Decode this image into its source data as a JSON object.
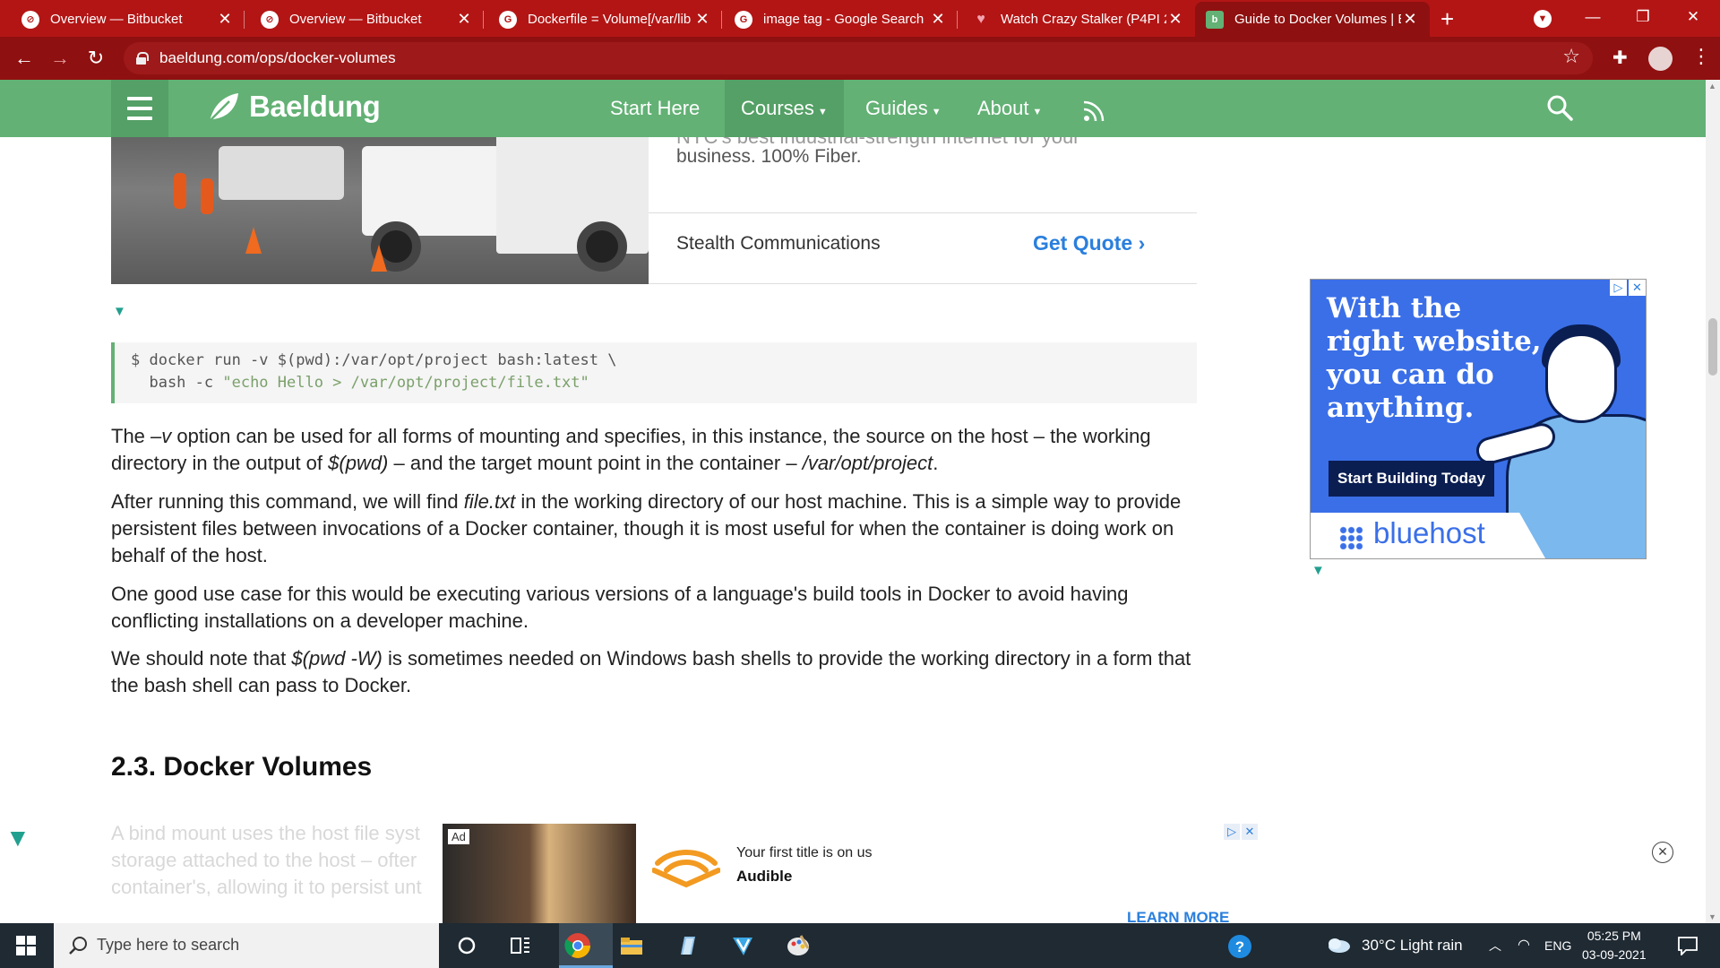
{
  "browser": {
    "tabs": [
      {
        "title": "Overview — Bitbucket",
        "icon": "bitbucket-icon"
      },
      {
        "title": "Overview — Bitbucket",
        "icon": "bitbucket-icon"
      },
      {
        "title": "Dockerfile = Volume[/var/lib",
        "icon": "google-icon"
      },
      {
        "title": "image tag - Google Search",
        "icon": "google-icon"
      },
      {
        "title": "Watch Crazy Stalker (P4PI 2",
        "icon": "heart-icon"
      },
      {
        "title": "Guide to Docker Volumes | B",
        "icon": "baeldung-icon"
      }
    ],
    "new_tab": "+",
    "url": "baeldung.com/ops/docker-volumes"
  },
  "site": {
    "logo": "Baeldung",
    "nav": [
      "Start Here",
      "Courses",
      "Guides",
      "About"
    ],
    "accent": "#63b175"
  },
  "top_ad": {
    "tagline_line1": "NYC's best industrial-strength internet for your",
    "tagline_line2": "business. 100% Fiber.",
    "advertiser": "Stealth Communications",
    "cta": "Get Quote"
  },
  "code": {
    "line1_pre": "$ docker run -v $(pwd):/var/opt/project bash:latest \\",
    "line2_pre": "  bash -c ",
    "line2_str": "\"echo Hello > /var/opt/project/file.txt\""
  },
  "article": {
    "p1": {
      "a": "The ",
      "b": "–v",
      "c": " option can be used for all forms of mounting and specifies, in this instance, the source on the host – the working directory in the output of ",
      "d": "$(pwd)",
      "e": " – and the target mount point in the container – ",
      "f": "/var/opt/project",
      "g": "."
    },
    "p2": {
      "a": "After running this command, we will find ",
      "b": "file.txt",
      "c": " in the working directory of our host machine. This is a simple way to provide persistent files between invocations of a Docker container, though it is most useful for when the container is doing work on behalf of the host."
    },
    "p3": "One good use case for this would be executing various versions of a language's build tools in Docker to avoid having conflicting installations on a developer machine.",
    "p4": {
      "a": "We should note that ",
      "b": "$(pwd -W)",
      "c": " is sometimes needed on Windows bash shells to provide the working directory in a form that the bash shell can pass to Docker."
    },
    "heading": "2.3. Docker Volumes",
    "faded_lines": [
      "A bind mount uses the host file syst",
      "storage attached to the host – ofter",
      "container's, allowing it to persist unt"
    ]
  },
  "side_ad": {
    "headline": "With the right website, you can do anything.",
    "cta": "Start Building Today",
    "brand": "bluehost"
  },
  "bottom_ad": {
    "label": "Ad",
    "line1": "Your first title is on us",
    "line2": "Audible",
    "cta": "LEARN MORE"
  },
  "taskbar": {
    "search_placeholder": "Type here to search",
    "weather": "30°C  Light rain",
    "lang": "ENG",
    "time": "05:25 PM",
    "date": "03-09-2021"
  }
}
